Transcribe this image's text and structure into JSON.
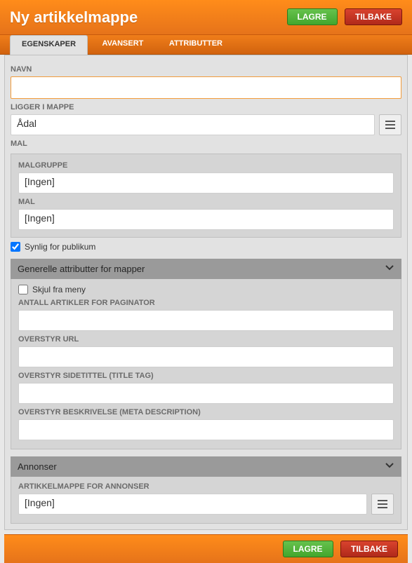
{
  "header": {
    "title": "Ny artikkelmappe",
    "save_label": "LAGRE",
    "back_label": "TILBAKE"
  },
  "tabs": {
    "egenskaper": "EGENSKAPER",
    "avansert": "AVANSERT",
    "attributter": "ATTRIBUTTER"
  },
  "fields": {
    "navn_label": "NAVN",
    "navn_value": "",
    "ligger_label": "LIGGER I MAPPE",
    "ligger_value": "Ådal",
    "mal_section_label": "MAL",
    "malgruppe_label": "MALGRUPPE",
    "malgruppe_value": "[Ingen]",
    "mal_label": "MAL",
    "mal_value": "[Ingen]",
    "synlig_label": "Synlig for publikum"
  },
  "section_general": {
    "title": "Generelle attributter for mapper",
    "skjul_label": "Skjul fra meny",
    "paginator_label": "ANTALL ARTIKLER FOR PAGINATOR",
    "paginator_value": "",
    "url_label": "OVERSTYR URL",
    "url_value": "",
    "titletag_label": "OVERSTYR SIDETITTEL (TITLE TAG)",
    "titletag_value": "",
    "metadesc_label": "OVERSTYR BESKRIVELSE (META DESCRIPTION)",
    "metadesc_value": ""
  },
  "section_ads": {
    "title": "Annonser",
    "mappe_label": "ARTIKKELMAPPE FOR ANNONSER",
    "mappe_value": "[Ingen]"
  },
  "footer": {
    "save_label": "LAGRE",
    "back_label": "TILBAKE"
  }
}
